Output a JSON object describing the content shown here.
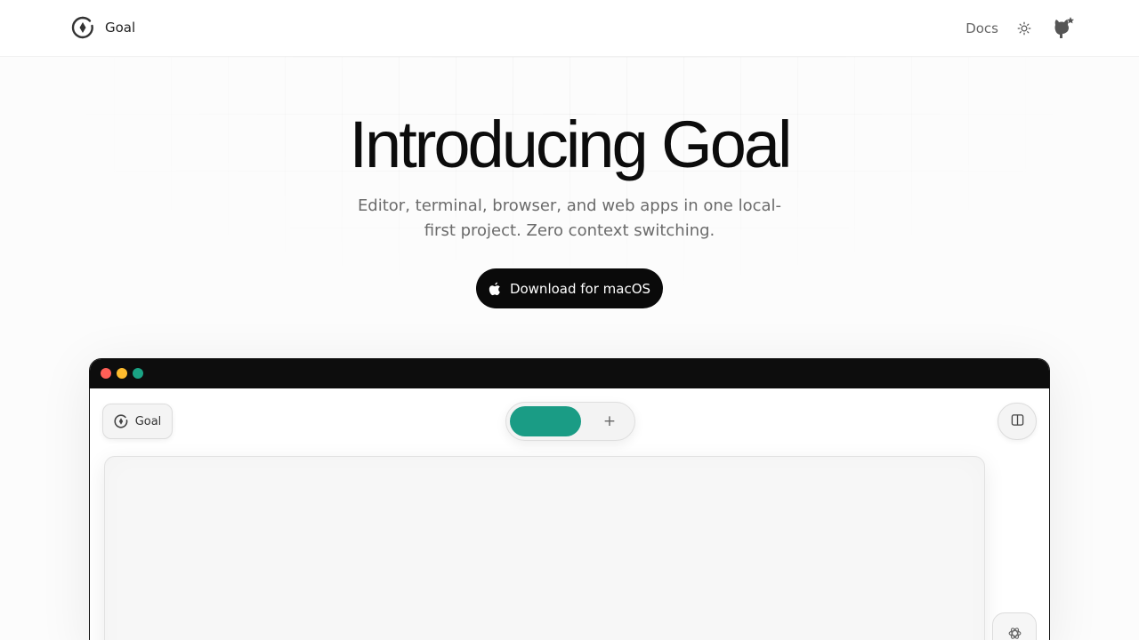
{
  "nav": {
    "brand_name": "Goal",
    "docs_label": "Docs",
    "icons": [
      "goal-logo-icon",
      "sun-icon",
      "github-star-icon"
    ]
  },
  "hero": {
    "title": "Introducing Goal",
    "subtitle": "Editor, terminal, browser, and web apps in one local-first project. Zero context switching.",
    "download_label": "Download for macOS",
    "download_icon": "apple-icon"
  },
  "app_window": {
    "traffic_lights": [
      "#ff5f57",
      "#febc2e",
      "#1aa384"
    ],
    "goal_chip_label": "Goal",
    "tab_add_label": "+",
    "accent_color": "#1a9c85",
    "icons": [
      "sidebar-toggle-icon",
      "openai-icon"
    ]
  }
}
